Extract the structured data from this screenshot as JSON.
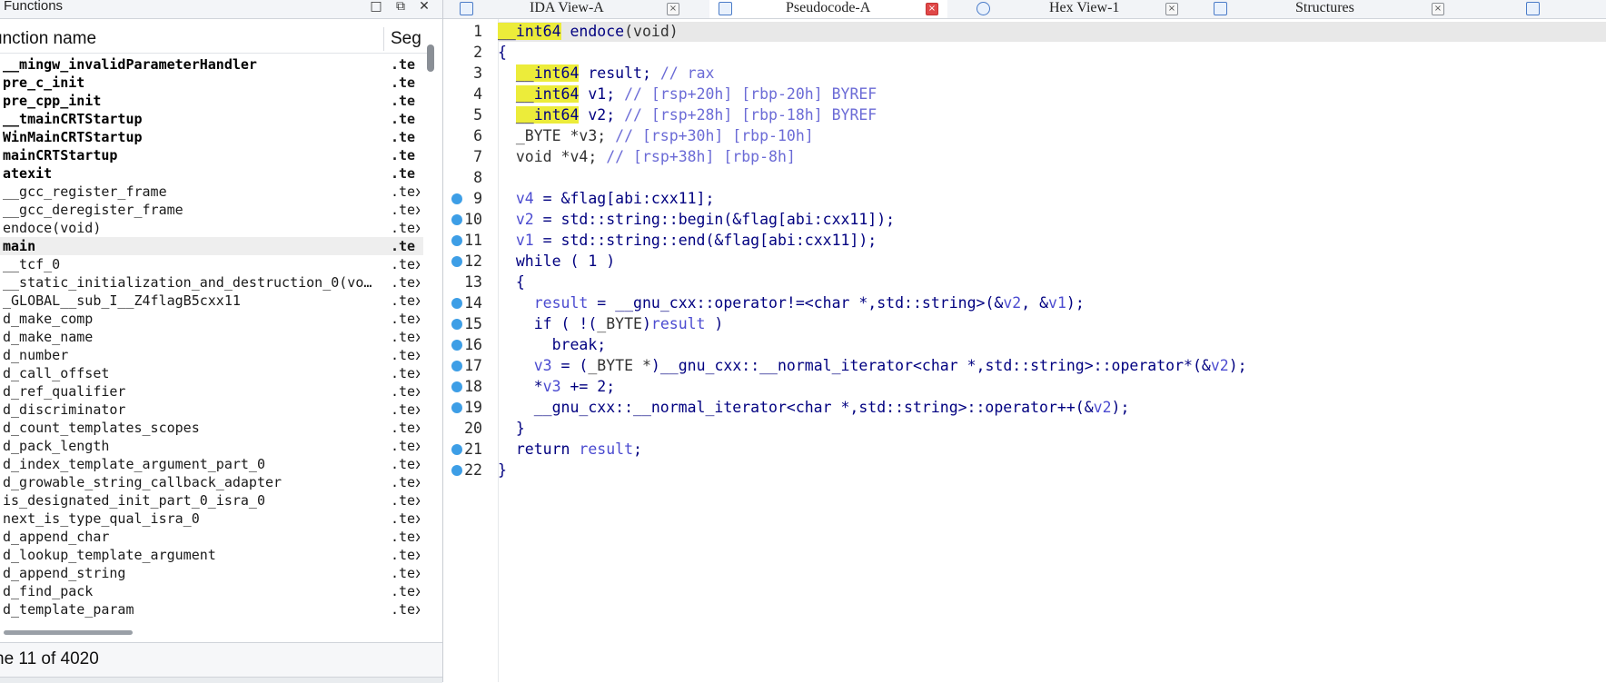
{
  "functions_panel": {
    "title": "Functions",
    "col_name": "unction name",
    "col_segment": "Seg",
    "status": "ne 11 of 4020",
    "rows": [
      {
        "name": "__mingw_invalidParameterHandler",
        "segment": ".te",
        "bold": true
      },
      {
        "name": "pre_c_init",
        "segment": ".te",
        "bold": true
      },
      {
        "name": "pre_cpp_init",
        "segment": ".te",
        "bold": true
      },
      {
        "name": "__tmainCRTStartup",
        "segment": ".te",
        "bold": true
      },
      {
        "name": "WinMainCRTStartup",
        "segment": ".te",
        "bold": true
      },
      {
        "name": "mainCRTStartup",
        "segment": ".te",
        "bold": true
      },
      {
        "name": "atexit",
        "segment": ".te",
        "bold": true
      },
      {
        "name": "__gcc_register_frame",
        "segment": ".tex",
        "bold": false
      },
      {
        "name": "__gcc_deregister_frame",
        "segment": ".tex",
        "bold": false
      },
      {
        "name": "endoce(void)",
        "segment": ".tex",
        "bold": false
      },
      {
        "name": "main",
        "segment": ".te",
        "bold": true,
        "selected": true
      },
      {
        "name": "__tcf_0",
        "segment": ".tex",
        "bold": false
      },
      {
        "name": "__static_initialization_and_destruction_0(vo…",
        "segment": ".tex",
        "bold": false
      },
      {
        "name": "_GLOBAL__sub_I__Z4flagB5cxx11",
        "segment": ".tex",
        "bold": false
      },
      {
        "name": "d_make_comp",
        "segment": ".tex",
        "bold": false
      },
      {
        "name": "d_make_name",
        "segment": ".tex",
        "bold": false
      },
      {
        "name": "d_number",
        "segment": ".tex",
        "bold": false
      },
      {
        "name": "d_call_offset",
        "segment": ".tex",
        "bold": false
      },
      {
        "name": "d_ref_qualifier",
        "segment": ".tex",
        "bold": false
      },
      {
        "name": "d_discriminator",
        "segment": ".tex",
        "bold": false
      },
      {
        "name": "d_count_templates_scopes",
        "segment": ".tex",
        "bold": false
      },
      {
        "name": "d_pack_length",
        "segment": ".tex",
        "bold": false
      },
      {
        "name": "d_index_template_argument_part_0",
        "segment": ".tex",
        "bold": false
      },
      {
        "name": "d_growable_string_callback_adapter",
        "segment": ".tex",
        "bold": false
      },
      {
        "name": "is_designated_init_part_0_isra_0",
        "segment": ".tex",
        "bold": false
      },
      {
        "name": "next_is_type_qual_isra_0",
        "segment": ".tex",
        "bold": false
      },
      {
        "name": "d_append_char",
        "segment": ".tex",
        "bold": false
      },
      {
        "name": "d_lookup_template_argument",
        "segment": ".tex",
        "bold": false
      },
      {
        "name": "d_append_string",
        "segment": ".tex",
        "bold": false
      },
      {
        "name": "d_find_pack",
        "segment": ".tex",
        "bold": false
      },
      {
        "name": "d_template_param",
        "segment": ".tex",
        "bold": false
      }
    ]
  },
  "tabs": [
    {
      "label": "IDA View-A",
      "active": false,
      "close": "×"
    },
    {
      "label": "Pseudocode-A",
      "active": true,
      "close": "×"
    },
    {
      "label": "Hex View-1",
      "active": false,
      "close": "×"
    },
    {
      "label": "Structures",
      "active": false,
      "close": "×"
    }
  ],
  "code": {
    "line_numbers": [
      "1",
      "2",
      "3",
      "4",
      "5",
      "6",
      "7",
      "8",
      "9",
      "10",
      "11",
      "12",
      "13",
      "14",
      "15",
      "16",
      "17",
      "18",
      "19",
      "20",
      "21",
      "22"
    ],
    "breakpoint_lines": [
      9,
      10,
      11,
      12,
      14,
      15,
      16,
      17,
      18,
      19,
      21,
      22
    ],
    "lines": [
      [
        [
          "ty",
          "__int64"
        ],
        [
          "kw",
          " endoce"
        ],
        [
          "plain",
          "(void)"
        ]
      ],
      [
        [
          "kw",
          "{"
        ]
      ],
      [
        [
          "kw",
          "  "
        ],
        [
          "ty",
          "__int64"
        ],
        [
          "kw",
          " result; "
        ],
        [
          "cm",
          "// rax"
        ]
      ],
      [
        [
          "kw",
          "  "
        ],
        [
          "ty",
          "__int64"
        ],
        [
          "kw",
          " v1; "
        ],
        [
          "cm",
          "// [rsp+20h] [rbp-20h] BYREF"
        ]
      ],
      [
        [
          "kw",
          "  "
        ],
        [
          "ty",
          "__int64"
        ],
        [
          "kw",
          " v2; "
        ],
        [
          "cm",
          "// [rsp+28h] [rbp-18h] BYREF"
        ]
      ],
      [
        [
          "plain",
          "  _BYTE *v3; "
        ],
        [
          "cm",
          "// [rsp+30h] [rbp-10h]"
        ]
      ],
      [
        [
          "plain",
          "  void *v4; "
        ],
        [
          "cm",
          "// [rsp+38h] [rbp-8h]"
        ]
      ],
      [
        [
          "kw",
          ""
        ]
      ],
      [
        [
          "kw",
          "  "
        ],
        [
          "vr",
          "v4"
        ],
        [
          "kw",
          " = &flag[abi:cxx11];"
        ]
      ],
      [
        [
          "kw",
          "  "
        ],
        [
          "vr",
          "v2"
        ],
        [
          "kw",
          " = std::string::begin(&flag[abi:cxx11]);"
        ]
      ],
      [
        [
          "kw",
          "  "
        ],
        [
          "vr",
          "v1"
        ],
        [
          "kw",
          " = std::string::end(&flag[abi:cxx11]);"
        ]
      ],
      [
        [
          "kw",
          "  while ( 1 )"
        ]
      ],
      [
        [
          "kw",
          "  {"
        ]
      ],
      [
        [
          "kw",
          "    "
        ],
        [
          "vr",
          "result"
        ],
        [
          "kw",
          " = __gnu_cxx::operator!=<char *,std::string>(&"
        ],
        [
          "vr",
          "v2"
        ],
        [
          "kw",
          ", &"
        ],
        [
          "vr",
          "v1"
        ],
        [
          "kw",
          ");"
        ]
      ],
      [
        [
          "kw",
          "    if ( !("
        ],
        [
          "plain",
          "_BYTE"
        ],
        [
          "kw",
          ")"
        ],
        [
          "vr",
          "result"
        ],
        [
          "kw",
          " )"
        ]
      ],
      [
        [
          "kw",
          "      break;"
        ]
      ],
      [
        [
          "kw",
          "    "
        ],
        [
          "vr",
          "v3"
        ],
        [
          "kw",
          " = ("
        ],
        [
          "plain",
          "_BYTE *"
        ],
        [
          "kw",
          ")__gnu_cxx::__normal_iterator<char *,std::string>::operator*(&"
        ],
        [
          "vr",
          "v2"
        ],
        [
          "kw",
          ");"
        ]
      ],
      [
        [
          "kw",
          "    *"
        ],
        [
          "vr",
          "v3"
        ],
        [
          "kw",
          " += 2;"
        ]
      ],
      [
        [
          "kw",
          "    __gnu_cxx::__normal_iterator<char *,std::string>::operator++(&"
        ],
        [
          "vr",
          "v2"
        ],
        [
          "kw",
          ");"
        ]
      ],
      [
        [
          "kw",
          "  }"
        ]
      ],
      [
        [
          "kw",
          "  return "
        ],
        [
          "vr",
          "result"
        ],
        [
          "kw",
          ";"
        ]
      ],
      [
        [
          "kw",
          "}"
        ]
      ]
    ]
  }
}
